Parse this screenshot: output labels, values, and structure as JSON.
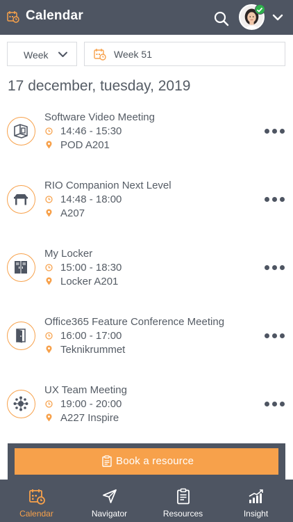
{
  "header": {
    "title": "Calendar"
  },
  "filters": {
    "period_label": "Week",
    "week_label": "Week 51"
  },
  "date_heading": "17 december, tuesday, 2019",
  "bookings": [
    {
      "name": "Software Video Meeting",
      "time": "14:46 - 15:30",
      "location": "POD A201",
      "icon": "pod-icon"
    },
    {
      "name": "RIO Companion Next Level",
      "time": "14:48 - 18:00",
      "location": "A207",
      "icon": "desk-icon"
    },
    {
      "name": "My Locker",
      "time": "15:00 - 18:30",
      "location": "Locker A201",
      "icon": "locker-icon"
    },
    {
      "name": "Office365 Feature Conference Meeting",
      "time": "16:00 - 17:00",
      "location": "Teknikrummet",
      "icon": "door-icon"
    },
    {
      "name": "UX Team Meeting",
      "time": "19:00 - 20:00",
      "location": "A227 Inspire",
      "icon": "team-icon"
    }
  ],
  "cta": {
    "label": "Book a resource"
  },
  "tabs": [
    {
      "label": "Calendar",
      "icon": "calendar-icon",
      "active": true
    },
    {
      "label": "Navigator",
      "icon": "navigation-arrow-icon",
      "active": false
    },
    {
      "label": "Resources",
      "icon": "clipboard-icon",
      "active": false
    },
    {
      "label": "Insight",
      "icon": "chart-growth-icon",
      "active": false
    }
  ],
  "colors": {
    "accent": "#f7a14b",
    "header_bg": "#4e5562",
    "text": "#555c65",
    "online": "#2eb24c"
  }
}
